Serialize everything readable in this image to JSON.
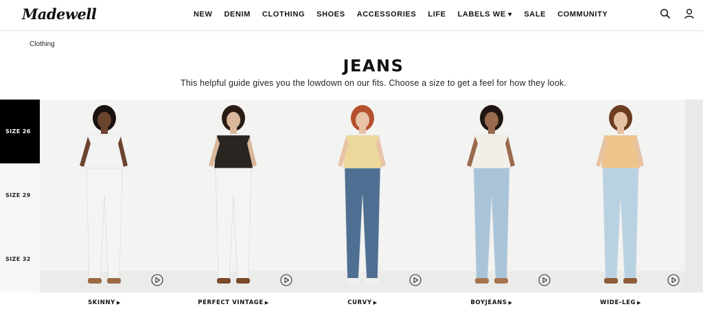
{
  "header": {
    "logo": "Madewell",
    "nav": [
      "NEW",
      "DENIM",
      "CLOTHING",
      "SHOES",
      "ACCESSORIES",
      "LIFE",
      "LABELS WE",
      "SALE",
      "COMMUNITY"
    ],
    "icons": [
      "search-icon",
      "account-icon"
    ]
  },
  "breadcrumb": "Clothing",
  "title": "JEANS",
  "subtitle": "This helpful guide gives you the lowdown on our fits. Choose a size to get a feel for how they look.",
  "sizes": {
    "items": [
      "SIZE 26",
      "SIZE 29",
      "SIZE 32"
    ],
    "selected": "SIZE 26"
  },
  "fits": [
    {
      "label": "SKINNY",
      "top_color": "#f3f3f3",
      "jeans_color": "#f4f4f2",
      "shoe_color": "#9a6a45"
    },
    {
      "label": "PERFECT VINTAGE",
      "top_color": "#2a2520",
      "jeans_color": "#f4f4f2",
      "shoe_color": "#7a4a2a"
    },
    {
      "label": "CURVY",
      "top_color": "#ecd89a",
      "jeans_color": "#4f6f92",
      "shoe_color": "#f0f0f0"
    },
    {
      "label": "BOYJEANS",
      "top_color": "#f2efe9",
      "jeans_color": "#a9c4d9",
      "shoe_color": "#a8744f"
    },
    {
      "label": "WIDE-LEG",
      "top_color": "#efc48c",
      "jeans_color": "#b9d2e3",
      "shoe_color": "#8f5b38"
    }
  ],
  "colors": {
    "accent": "#000000",
    "background": "#ffffff",
    "size_panel": "#f7f7f7"
  }
}
